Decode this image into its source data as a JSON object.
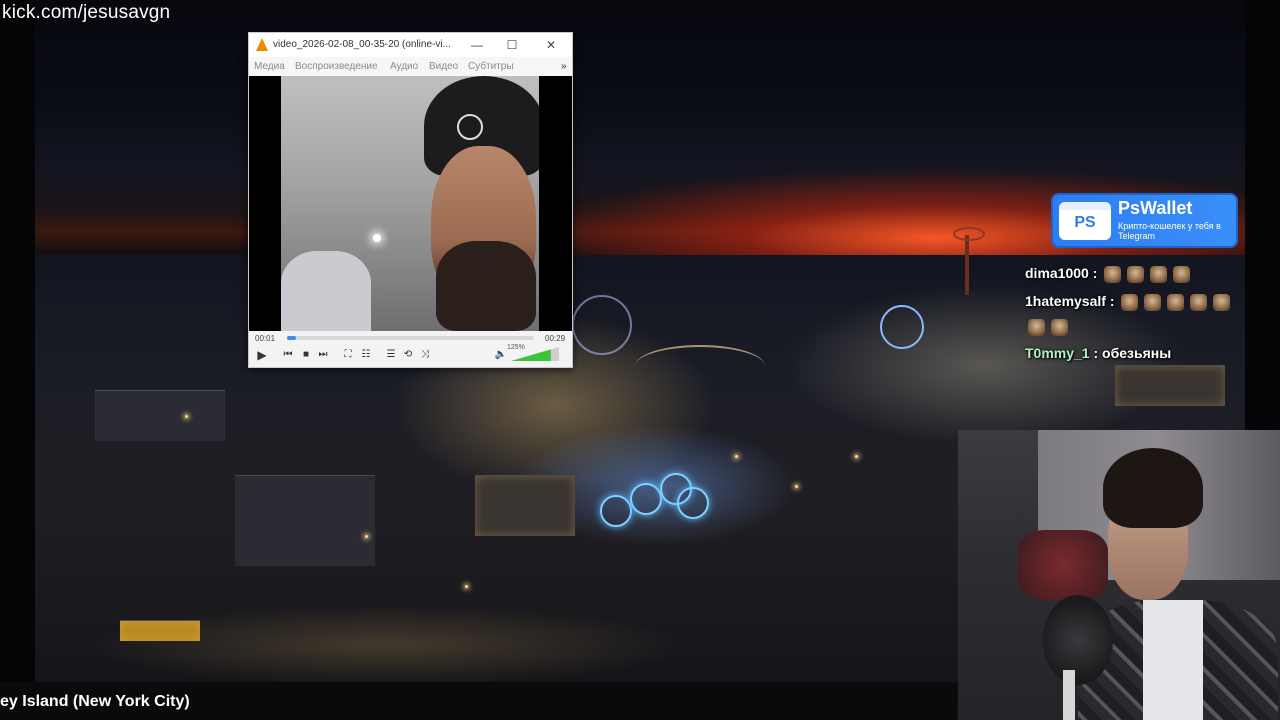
{
  "stream": {
    "url": "kick.com/jesusavgn",
    "caption": "ey Island (New York City)"
  },
  "vlc": {
    "title": "video_2026-02-08_00-35-20 (online-vi...",
    "menu": [
      "Медиа",
      "Воспроизведение",
      "Аудио",
      "Видео",
      "Субтитры"
    ],
    "menu_more": "»",
    "elapsed": "00:01",
    "duration": "00:29",
    "progress_fraction": 0.035,
    "volume_label": "125%",
    "volume_fraction": 0.83,
    "window_buttons": {
      "minimize": "—",
      "maximize": "☐",
      "close": "✕"
    },
    "control_icons": [
      "play-icon",
      "previous-icon",
      "stop-icon",
      "next-icon",
      "fullscreen-icon",
      "extended-settings-icon",
      "playlist-icon",
      "loop-icon",
      "shuffle-icon",
      "volume-icon"
    ]
  },
  "ad": {
    "logo": "PS",
    "title": "PsWallet",
    "subtitle": "Крипто-кошелек у тебя в Telegram"
  },
  "chat": [
    {
      "user": "dima1000",
      "message": "",
      "emotes": 4
    },
    {
      "user": "1hatemysalf",
      "message": "",
      "emotes": 7
    },
    {
      "user": "T0mmy_1",
      "message": "обезьяны",
      "emotes": 0
    }
  ],
  "colors": {
    "accent_blue": "#2c7df2",
    "vlc_orange": "#f08a00",
    "seek_blue": "#3a8de0",
    "volume_green": "#3cc43c"
  }
}
